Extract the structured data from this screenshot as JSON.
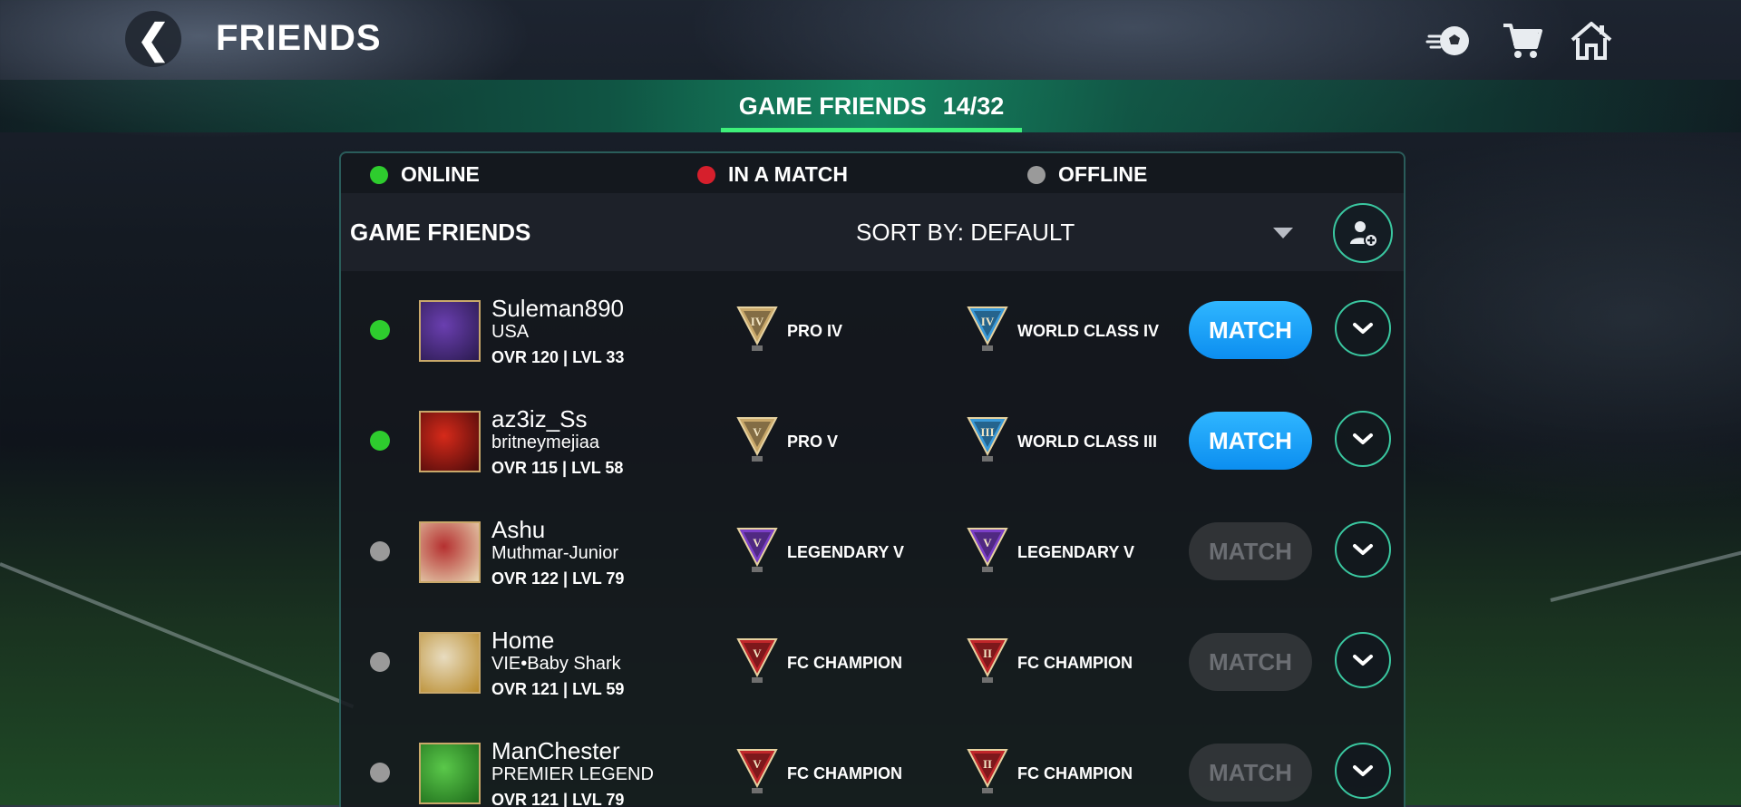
{
  "header": {
    "title": "FRIENDS",
    "back_icon": "back-chevron-icon",
    "icons": [
      "football-icon",
      "cart-icon",
      "home-icon"
    ]
  },
  "tab": {
    "label": "GAME FRIENDS",
    "count": "14/32"
  },
  "legend": [
    {
      "label": "ONLINE",
      "color": "#2ecc2e"
    },
    {
      "label": "IN A MATCH",
      "color": "#d61f2c"
    },
    {
      "label": "OFFLINE",
      "color": "#9a9a9a"
    }
  ],
  "list_header": {
    "title": "GAME FRIENDS",
    "sort_label": "SORT BY: DEFAULT",
    "add_friend_icon": "add-friend-icon"
  },
  "friends": [
    {
      "name": "Suleman890",
      "sub": "USA",
      "ovr": "OVR 120 | LVL 33",
      "status": "online",
      "avatar_colors": [
        "#6a3fb0",
        "#2a1a4e"
      ],
      "rank1": {
        "label": "PRO IV",
        "numeral": "IV",
        "color": "#c9a86a"
      },
      "rank2": {
        "label": "WORLD CLASS IV",
        "numeral": "IV",
        "color": "#3a9ad9"
      },
      "match_label": "MATCH",
      "match_enabled": true
    },
    {
      "name": "az3iz_Ss",
      "sub": "britneymejiaa",
      "ovr": "OVR 115 | LVL 58",
      "status": "online",
      "avatar_colors": [
        "#d62a1a",
        "#4a0a0a"
      ],
      "rank1": {
        "label": "PRO V",
        "numeral": "V",
        "color": "#c9a86a"
      },
      "rank2": {
        "label": "WORLD CLASS III",
        "numeral": "III",
        "color": "#3a9ad9"
      },
      "match_label": "MATCH",
      "match_enabled": true
    },
    {
      "name": "Ashu",
      "sub": "Muthmar-Junior",
      "ovr": "OVR 122 | LVL 79",
      "status": "offline",
      "avatar_colors": [
        "#b53030",
        "#e8d9b5"
      ],
      "rank1": {
        "label": "LEGENDARY V",
        "numeral": "V",
        "color": "#7b3fc8"
      },
      "rank2": {
        "label": "LEGENDARY V",
        "numeral": "V",
        "color": "#7b3fc8"
      },
      "match_label": "MATCH",
      "match_enabled": false
    },
    {
      "name": "Home",
      "sub": "VIE•Baby Shark",
      "ovr": "OVR 121 | LVL 59",
      "status": "offline",
      "avatar_colors": [
        "#e8dcc0",
        "#b88a2a"
      ],
      "rank1": {
        "label": "FC CHAMPION",
        "numeral": "V",
        "color": "#c0262a"
      },
      "rank2": {
        "label": "FC CHAMPION",
        "numeral": "II",
        "color": "#c0262a"
      },
      "match_label": "MATCH",
      "match_enabled": false
    },
    {
      "name": "ManChester",
      "sub": "PREMIER LEGEND",
      "ovr": "OVR 121 | LVL 79",
      "status": "offline",
      "avatar_colors": [
        "#5ac84a",
        "#1d6a1a"
      ],
      "rank1": {
        "label": "FC CHAMPION",
        "numeral": "V",
        "color": "#c0262a"
      },
      "rank2": {
        "label": "FC CHAMPION",
        "numeral": "II",
        "color": "#c0262a"
      },
      "match_label": "MATCH",
      "match_enabled": false
    }
  ]
}
